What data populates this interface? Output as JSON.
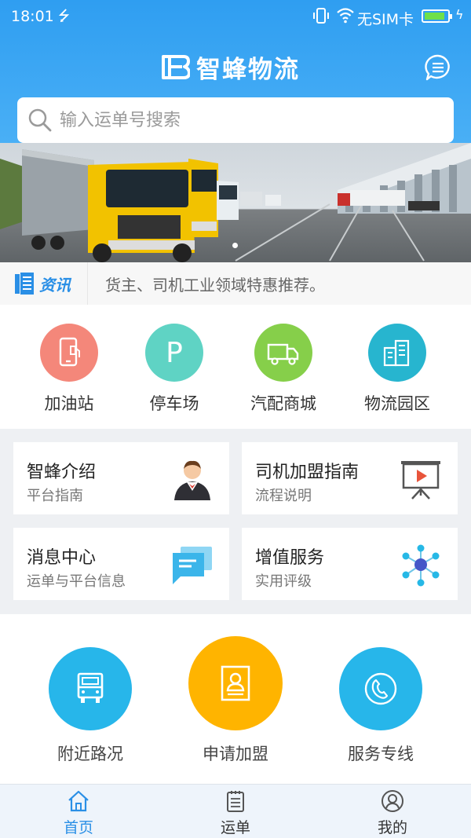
{
  "status_bar": {
    "time": "18:01",
    "carrier": "无SIM卡",
    "battery_level": 0.9
  },
  "header": {
    "app_name": "智蜂物流"
  },
  "search": {
    "placeholder": "输入运单号搜索"
  },
  "news": {
    "badge": "资讯",
    "text": "货主、司机工业领域特惠推荐。"
  },
  "quick_entries": [
    {
      "label": "加油站",
      "icon": "fuel-phone-icon",
      "color": "#f4877a"
    },
    {
      "label": "停车场",
      "icon": "parking-icon",
      "color": "#5fd3c4"
    },
    {
      "label": "汽配商城",
      "icon": "truck-icon",
      "color": "#86cf4a"
    },
    {
      "label": "物流园区",
      "icon": "buildings-icon",
      "color": "#27b5cf"
    }
  ],
  "cards": [
    {
      "title": "智蜂介绍",
      "subtitle": "平台指南",
      "icon": "waiter-icon"
    },
    {
      "title": "司机加盟指南",
      "subtitle": "流程说明",
      "icon": "presentation-board-icon"
    },
    {
      "title": "消息中心",
      "subtitle": "运单与平台信息",
      "icon": "chat-bubbles-icon"
    },
    {
      "title": "增值服务",
      "subtitle": "实用评级",
      "icon": "network-nodes-icon"
    }
  ],
  "actions": [
    {
      "label": "附近路况",
      "icon": "truck-front-icon",
      "color": "#27b6ea"
    },
    {
      "label": "申请加盟",
      "icon": "profile-card-icon",
      "color": "#ffb400"
    },
    {
      "label": "服务专线",
      "icon": "phone-icon",
      "color": "#27b6ea"
    }
  ],
  "tabs": [
    {
      "label": "首页",
      "icon": "home-icon",
      "active": true
    },
    {
      "label": "运单",
      "icon": "waybill-icon",
      "active": false
    },
    {
      "label": "我的",
      "icon": "user-icon",
      "active": false
    }
  ],
  "colors": {
    "primary": "#2f9ef1",
    "accent": "#2a8fe6"
  }
}
